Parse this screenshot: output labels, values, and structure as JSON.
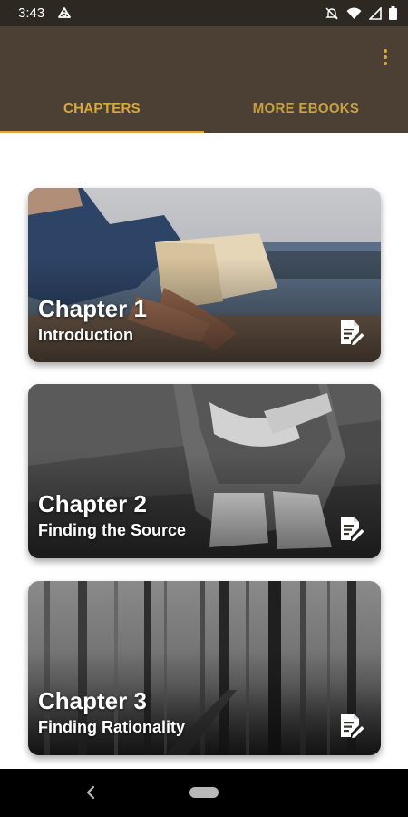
{
  "status_bar": {
    "time": "3:43",
    "icons": [
      "notification-app-icon",
      "mute-icon",
      "wifi-icon",
      "signal-icon",
      "battery-icon"
    ]
  },
  "app_bar": {
    "menu_icon": "more-vert-icon",
    "accent_color": "#d9a93a",
    "background_color": "#4b4033"
  },
  "tabs": [
    {
      "label": "CHAPTERS",
      "selected": true
    },
    {
      "label": "MORE EBOOKS",
      "selected": false
    }
  ],
  "chapters": [
    {
      "title": "Chapter 1",
      "subtitle": "Introduction",
      "icon": "edit-note-icon",
      "image": "person reading a book by the water"
    },
    {
      "title": "Chapter 2",
      "subtitle": "Finding the Source",
      "icon": "edit-note-icon",
      "image": "person sitting hugging knees, grayscale"
    },
    {
      "title": "Chapter 3",
      "subtitle": "Finding Rationality",
      "icon": "edit-note-icon",
      "image": "foggy dark forest"
    }
  ],
  "nav_bar": {
    "back_icon": "back-chevron-icon",
    "home_icon": "home-pill-icon"
  }
}
